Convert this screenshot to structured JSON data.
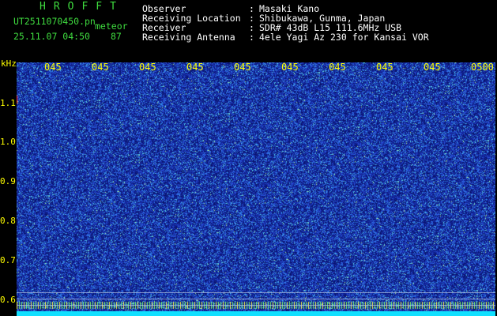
{
  "header": {
    "logo": "HROFFT",
    "filename": "UT2511070450.pn",
    "meteor_label": "meteor",
    "datetime": "25.11.07 04:50",
    "count": "87",
    "fields": [
      {
        "label": "Observer",
        "value": "Masaki Kano"
      },
      {
        "label": "Receiving Location",
        "value": "Shibukawa, Gunma, Japan"
      },
      {
        "label": "Receiver",
        "value": "SDR# 43dB L15 111.6MHz USB"
      },
      {
        "label": "Receiving Antenna",
        "value": "4ele Yagi Az 230 for Kansai VOR"
      }
    ]
  },
  "axis": {
    "y_unit": "kHz",
    "y_ticks": [
      "1.1",
      "1.0",
      "0.9",
      "0.8",
      "0.7",
      "0.6"
    ],
    "x_ticks": [
      "045",
      "045",
      "045",
      "045",
      "045",
      "045",
      "045",
      "045",
      "045",
      "045",
      "0500"
    ]
  },
  "colors": {
    "background": "#000000",
    "waterfall_base": "#1a2ea0",
    "label_green": "#3fdc3f",
    "label_yellow": "#ffff00",
    "label_white": "#ffffff",
    "baseline": "#10e0ff"
  }
}
